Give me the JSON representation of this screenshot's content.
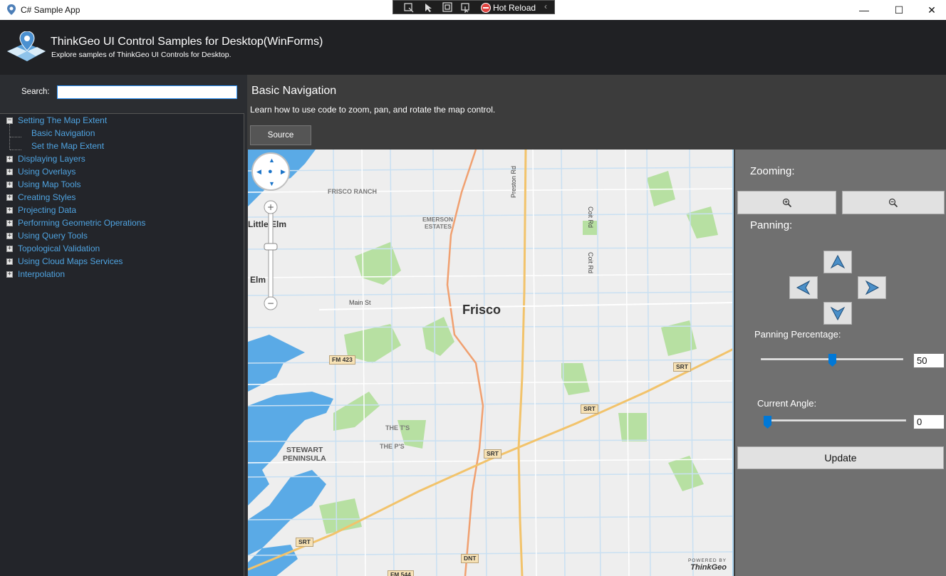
{
  "window": {
    "title": "C# Sample App",
    "hot_reload_label": "Hot Reload",
    "minimize": "—",
    "maximize": "☐",
    "close": "✕"
  },
  "header": {
    "title": "ThinkGeo UI Control Samples for Desktop(WinForms)",
    "subtitle": "Explore samples of ThinkGeo UI Controls for Desktop."
  },
  "sidebar": {
    "search_label": "Search:",
    "search_value": "",
    "tree": [
      {
        "label": "Setting The Map Extent",
        "expanded": true,
        "children": [
          {
            "label": "Basic Navigation"
          },
          {
            "label": "Set the Map Extent"
          }
        ]
      },
      {
        "label": "Displaying Layers",
        "expanded": false
      },
      {
        "label": "Using Overlays",
        "expanded": false
      },
      {
        "label": "Using Map Tools",
        "expanded": false
      },
      {
        "label": "Creating Styles",
        "expanded": false
      },
      {
        "label": "Projecting Data",
        "expanded": false
      },
      {
        "label": "Performing Geometric Operations",
        "expanded": false
      },
      {
        "label": "Using Query Tools",
        "expanded": false
      },
      {
        "label": "Topological Validation",
        "expanded": false
      },
      {
        "label": "Using Cloud Maps Services",
        "expanded": false
      },
      {
        "label": "Interpolation",
        "expanded": false
      }
    ]
  },
  "content": {
    "title": "Basic Navigation",
    "description": "Learn how to use code to zoom, pan, and rotate the map control.",
    "source_button": "Source"
  },
  "map": {
    "labels": {
      "frisco": "Frisco",
      "frisco_ranch": "FRISCO RANCH",
      "emerson_estates_1": "EMERSON",
      "emerson_estates_2": "ESTATES",
      "little_elm": "Little Elm",
      "elm": "Elm",
      "main_st": "Main St",
      "preston_rd": "Preston Rd",
      "coit_rd_1": "Coit Rd",
      "coit_rd_2": "Coit Rd",
      "the_ts": "THE T'S",
      "the_ps": "THE P'S",
      "stewart_1": "STEWART",
      "stewart_2": "PENINSULA"
    },
    "shields": {
      "fm423": "FM 423",
      "srt1": "SRT",
      "srt2": "SRT",
      "srt3": "SRT",
      "srt4": "SRT",
      "dnt": "DNT",
      "fm544": "FM 544"
    },
    "powered_by": "POWERED BY",
    "brand": "ThinkGeo"
  },
  "panel": {
    "zooming_label": "Zooming:",
    "panning_label": "Panning:",
    "panning_percentage_label": "Panning Percentage:",
    "panning_percentage_value": "50",
    "panning_slider_fraction": 0.5,
    "current_angle_label": "Current Angle:",
    "current_angle_value": "0",
    "angle_slider_fraction": 0,
    "update_button": "Update"
  }
}
